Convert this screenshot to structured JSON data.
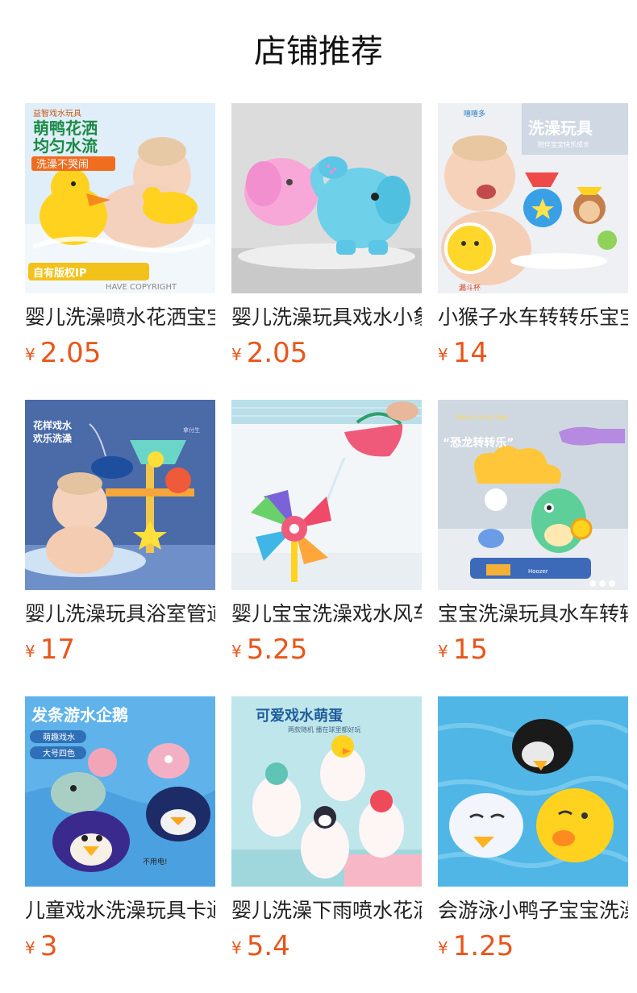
{
  "header": {
    "title": "店铺推荐"
  },
  "currency_symbol": "¥",
  "products": [
    {
      "name": "婴儿洗澡喷水花洒宝宝",
      "price": "2.05",
      "thumb_icon": "duck-shower-toy-icon",
      "img_text": [
        "益智戏水玩具",
        "萌鸭花洒",
        "均匀水流",
        "洗澡不哭闹",
        "自有版权IP",
        "HAVE COPYRIGHT"
      ]
    },
    {
      "name": "婴儿洗澡玩具戏水小象",
      "price": "2.05",
      "thumb_icon": "elephant-watering-can-icon",
      "img_text": []
    },
    {
      "name": "小猴子水车转转乐宝宝",
      "price": "14",
      "thumb_icon": "monkey-waterwheel-icon",
      "img_text": [
        "嘻嘻多",
        "洗澡玩具",
        "陪伴宝宝快乐成长",
        "漏斗杯"
      ]
    },
    {
      "name": "婴儿洗澡玩具浴室管道",
      "price": "17",
      "thumb_icon": "whale-pipe-toy-icon",
      "img_text": [
        "花样戏水",
        "欢乐洗澡",
        "拿付生"
      ]
    },
    {
      "name": "婴儿宝宝洗澡戏水风车",
      "price": "5.25",
      "thumb_icon": "pinwheel-bucket-icon",
      "img_text": []
    },
    {
      "name": "宝宝洗澡玩具水车转转",
      "price": "15",
      "thumb_icon": "dinosaur-waterwheel-icon",
      "img_text": [
        "Have a nice day",
        "“恐龙转转乐”",
        "Hoozer"
      ]
    },
    {
      "name": "儿童戏水洗澡玩具卡通",
      "price": "3",
      "thumb_icon": "swimming-penguin-icon",
      "img_text": [
        "发条游水企鹅",
        "萌趣戏水",
        "大号四色",
        "不用电!"
      ]
    },
    {
      "name": "婴儿洗澡下雨喷水花洒",
      "price": "5.4",
      "thumb_icon": "eggs-shower-toy-icon",
      "img_text": [
        "可爱戏水萌蛋",
        "两款随机 播在球里都好玩"
      ]
    },
    {
      "name": "会游泳小鸭子宝宝洗澡",
      "price": "1.25",
      "thumb_icon": "swimming-duck-icon",
      "img_text": []
    }
  ]
}
